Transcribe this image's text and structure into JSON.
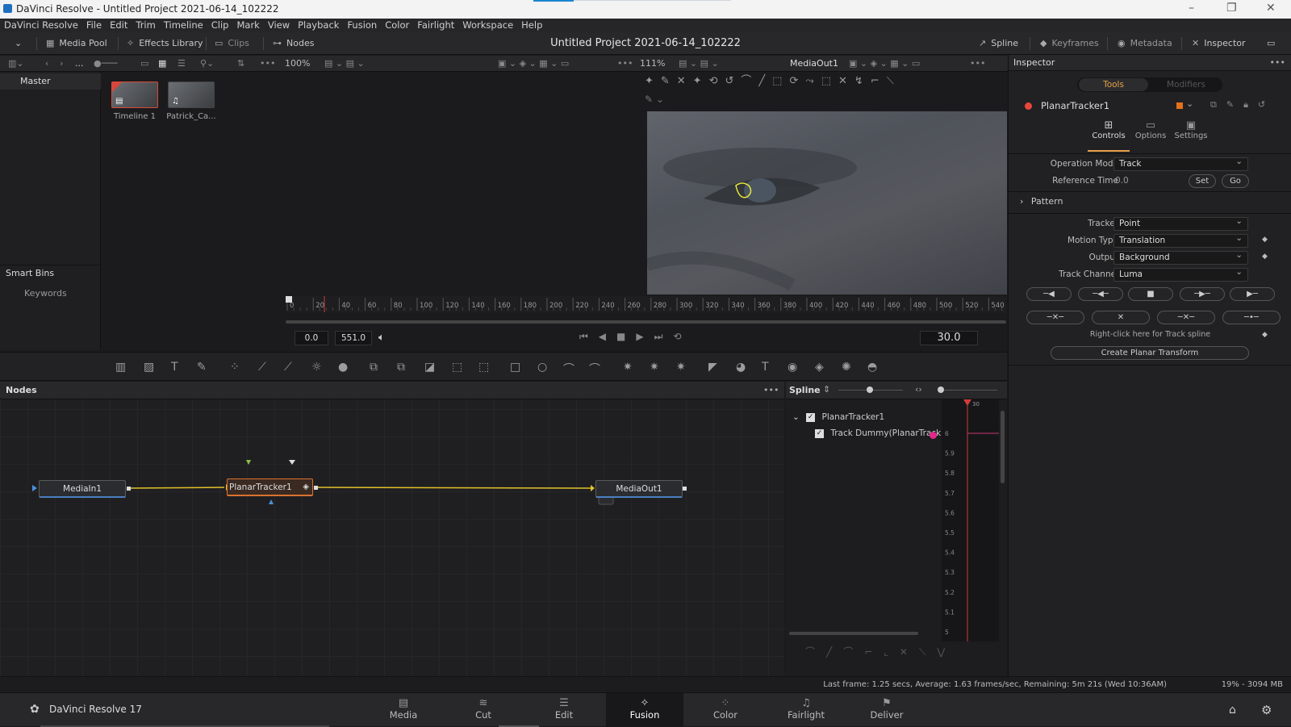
{
  "window": {
    "title": "DaVinci Resolve - Untitled Project 2021-06-14_102222"
  },
  "menu": [
    "DaVinci Resolve",
    "File",
    "Edit",
    "Trim",
    "Timeline",
    "Clip",
    "Mark",
    "View",
    "Playback",
    "Fusion",
    "Color",
    "Fairlight",
    "Workspace",
    "Help"
  ],
  "toolbar": {
    "media_pool": "Media Pool",
    "effects_library": "Effects Library",
    "clips": "Clips",
    "nodes": "Nodes",
    "project_title": "Untitled Project 2021-06-14_102222",
    "spline": "Spline",
    "keyframes": "Keyframes",
    "metadata": "Metadata",
    "inspector": "Inspector"
  },
  "media": {
    "ellipsis": "...",
    "zoom_left": "100%",
    "zoom_right": "111%",
    "viewer_name": "MediaOut1",
    "bins": {
      "master": "Master",
      "smart_bins": "Smart Bins",
      "keywords": "Keywords"
    },
    "clips": [
      {
        "name": "Timeline 1",
        "icon": "timeline-icon"
      },
      {
        "name": "Patrick_Ca...",
        "icon": "music-note-icon"
      }
    ]
  },
  "ruler": {
    "ticks": [
      "0",
      "20",
      "40",
      "60",
      "80",
      "100",
      "120",
      "140",
      "160",
      "180",
      "200",
      "220",
      "240",
      "260",
      "280",
      "300",
      "320",
      "340",
      "360",
      "380",
      "400",
      "420",
      "440",
      "460",
      "480",
      "500",
      "520",
      "540"
    ]
  },
  "transport": {
    "start": "0.0",
    "end": "551.0",
    "fps": "30.0"
  },
  "nodes_panel": {
    "title": "Nodes",
    "nodes": [
      {
        "label": "MediaIn1"
      },
      {
        "label": "PlanarTracker1"
      },
      {
        "label": "MediaOut1"
      }
    ]
  },
  "spline_panel": {
    "title": "Spline",
    "tree": [
      {
        "label": "PlanarTracker1",
        "checked": true
      },
      {
        "label": "Track Dummy(PlanarTrack",
        "checked": true
      }
    ],
    "playhead": "30",
    "yticks": [
      "6",
      "5.9",
      "5.8",
      "5.7",
      "5.6",
      "5.5",
      "5.4",
      "5.3",
      "5.2",
      "5.1",
      "5"
    ]
  },
  "inspector": {
    "title": "Inspector",
    "tabs": [
      "Tools",
      "Modifiers"
    ],
    "tool_name": "PlanarTracker1",
    "subtabs": [
      "Controls",
      "Options",
      "Settings"
    ],
    "operation_mode": {
      "label": "Operation Mode",
      "value": "Track"
    },
    "reference_time": {
      "label": "Reference Time",
      "value": "0.0",
      "set": "Set",
      "go": "Go"
    },
    "pattern": "Pattern",
    "tracker": {
      "label": "Tracker",
      "value": "Point"
    },
    "motion_type": {
      "label": "Motion Type",
      "value": "Translation"
    },
    "output": {
      "label": "Output",
      "value": "Background"
    },
    "track_channel": {
      "label": "Track Channel",
      "value": "Luma"
    },
    "spline_hint": "Right-click here for Track spline",
    "create_transform": "Create Planar Transform"
  },
  "status": {
    "message": "Last frame: 1.25 secs, Average: 1.63 frames/sec, Remaining: 5m 21s (Wed 10:36AM)",
    "memory": "19% - 3094 MB"
  },
  "pages": {
    "app": "DaVinci Resolve 17",
    "items": [
      {
        "label": "Media",
        "active": false
      },
      {
        "label": "Cut",
        "active": false
      },
      {
        "label": "Edit",
        "active": false
      },
      {
        "label": "Fusion",
        "active": true
      },
      {
        "label": "Color",
        "active": false
      },
      {
        "label": "Fairlight",
        "active": false
      },
      {
        "label": "Deliver",
        "active": false
      }
    ]
  },
  "colors": {
    "accent": "#e8483c",
    "node_selected": "#d9722f",
    "connection": "#e2c12a",
    "tracker_outline": "#e6e63a"
  }
}
